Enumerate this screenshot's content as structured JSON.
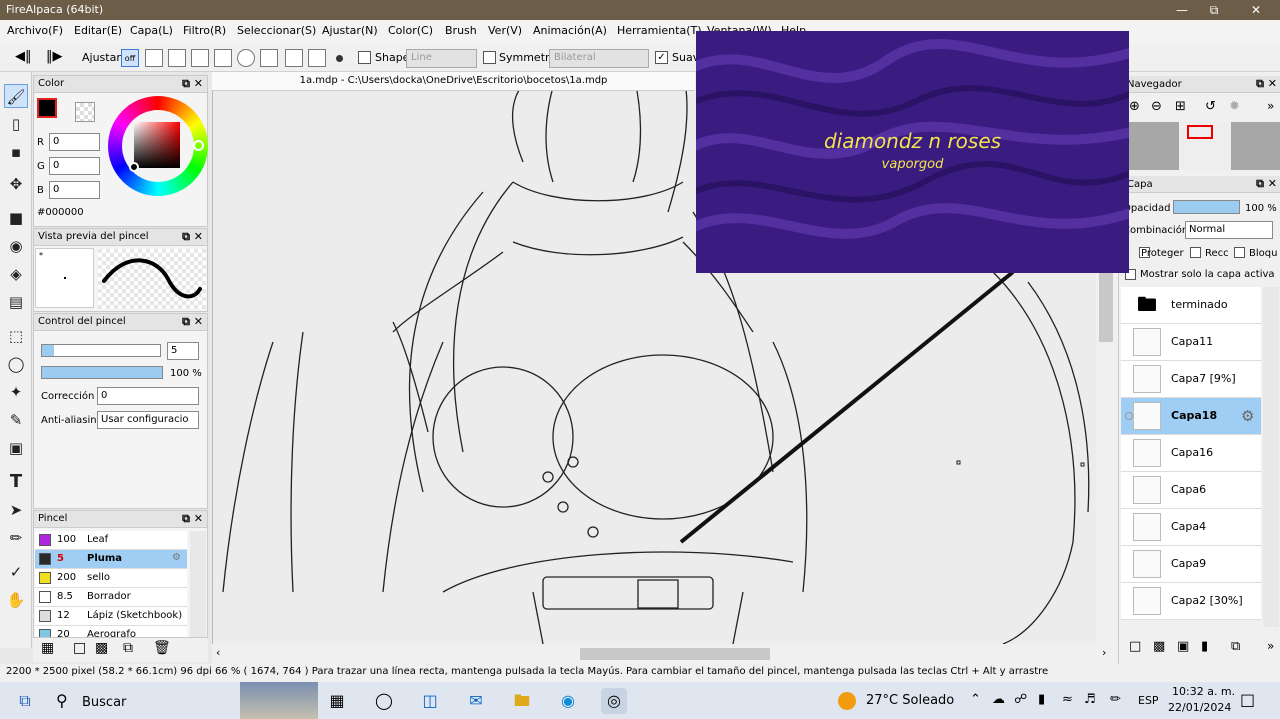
{
  "titlebar": {
    "title": "FireAlpaca (64bit)",
    "minimize": "—",
    "maximize": "⧉",
    "close": "✕"
  },
  "menu": [
    "Archivo(F)",
    "Editar(E)",
    "Capa(L)",
    "Filtro(R)",
    "Seleccionar(S)",
    "Ajustar(N)",
    "Color(C)",
    "Brush",
    "Ver(V)",
    "Animación(A)",
    "Herramienta(T)",
    "Ventana(W)",
    "Help"
  ],
  "toolbar": {
    "ajustar": "Ajustar",
    "off": "off",
    "shape_label": "Shape",
    "shape_value": "Line",
    "symmetry_label": "Symmetry",
    "symmetry_value": "Bilateral",
    "suavizado": "Suavi"
  },
  "color_panel": {
    "title": "Color",
    "r_label": "R",
    "r": "0",
    "g_label": "G",
    "g": "0",
    "b_label": "B",
    "b": "0",
    "hex": "#000000",
    "foreground": "#000000"
  },
  "brush_preview": {
    "title": "Vista previa del pincel",
    "dot": "*"
  },
  "brush_control": {
    "title": "Control del pincel",
    "size": "5",
    "opacity": "100 %",
    "opacity_fill": 1.0,
    "size_fill": 0.1,
    "correction_label": "Corrección",
    "correction": "0",
    "antialias_label": "Anti-aliasing",
    "antialias": "Usar configuracio"
  },
  "brush_list": {
    "title": "Pincel",
    "items": [
      {
        "size": "100",
        "name": "Leaf",
        "color": "#b126e0"
      },
      {
        "size": "5",
        "name": "Pluma",
        "color": "#2a2a2a",
        "selected": true
      },
      {
        "size": "200",
        "name": "sello",
        "color": "#f0e020"
      },
      {
        "size": "8.5",
        "name": "Borrador",
        "color": "#ffffff"
      },
      {
        "size": "12",
        "name": "Lápiz (Sketchbook)",
        "color": "#dddddd"
      },
      {
        "size": "20",
        "name": "Aerografo",
        "color": "#7ec8e3"
      }
    ]
  },
  "document": {
    "tab": "1a.mdp - C:\\Users\\docka\\OneDrive\\Escritorio\\bocetos\\1a.mdp"
  },
  "popup": {
    "title": "diamondz n roses",
    "artist": "vaporgod"
  },
  "navigator": {
    "title": "Navegador"
  },
  "layer_panel": {
    "title": "Capa",
    "opacity_label": "Opacidad",
    "opacity": "100 %",
    "blend_label": "Combinación",
    "blend": "Normal",
    "protect": "Proteger",
    "rec": "Recc",
    "lock": "Bloqu",
    "show_active": "Mostrar solo la capa activa",
    "layers": [
      "terminado",
      "Capa11",
      "Capa7 [9%]",
      "Capa18",
      "Capa16",
      "Capa6",
      "Capa4",
      "Capa9",
      "Capa2 [30%]"
    ],
    "selected": "Capa18"
  },
  "status": {
    "text": "2200 * 2500 pixel  (58.2 * 66.1cm)  96 dpi  66 %  ( 1674, 764 )  Para trazar una línea recta, mantenga pulsada la tecla Mayús. Para cambiar el tamaño del pincel, mantenga pulsada las teclas Ctrl + Alt y arrastre"
  },
  "taskbar": {
    "search": "Buscar",
    "weather": "27°C  Soleado",
    "lang": "ESP",
    "time": "10:32 a. m.",
    "date": "22/01/2024"
  }
}
